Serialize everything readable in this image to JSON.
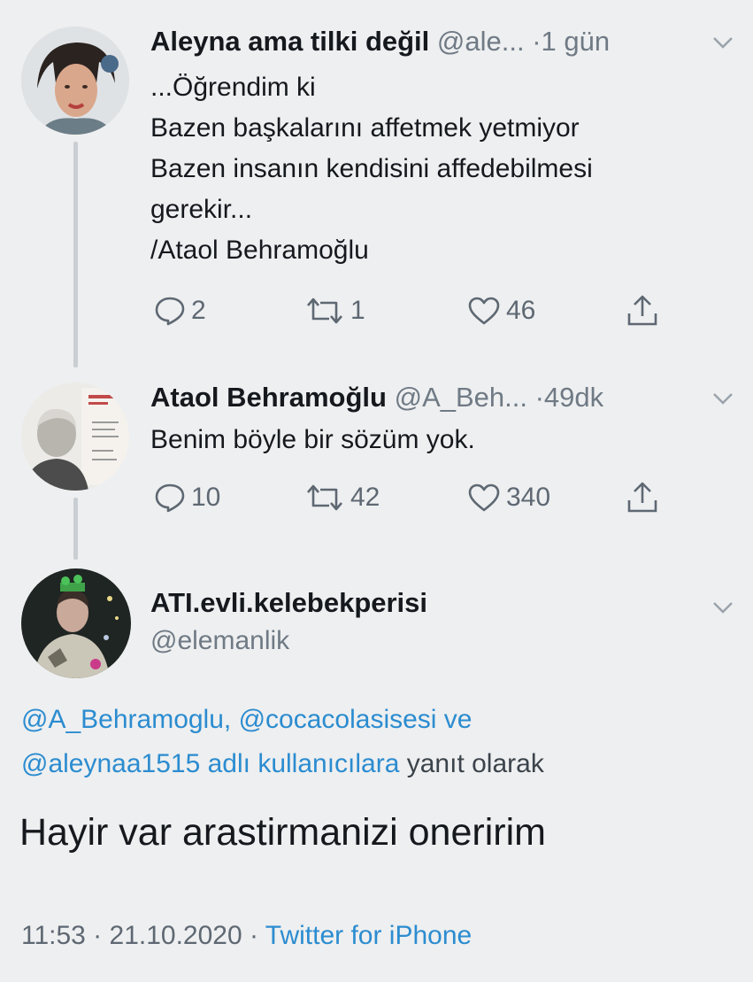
{
  "colors": {
    "background": "#eeeff0",
    "text": "#15191e",
    "muted": "#6f7a85",
    "link": "#2b8cd0"
  },
  "tweet1": {
    "name": "Aleyna ama tilki değil",
    "handle": "@ale...",
    "time": "·1 gün",
    "lines": [
      "...Öğrendim ki",
      "Bazen başkalarını affetmek yetmiyor",
      "Bazen insanın kendisini affedebilmesi",
      "gerekir...",
      " /Ataol Behramoğlu"
    ],
    "replies": "2",
    "retweets": "1",
    "likes": "46",
    "icons": [
      "reply-icon",
      "retweet-icon",
      "like-icon",
      "share-icon",
      "chevron-down-icon"
    ]
  },
  "tweet2": {
    "name": "Ataol Behramoğlu",
    "handle": "@A_Beh...",
    "time": "·49dk",
    "text": "Benim böyle bir sözüm yok.",
    "replies": "10",
    "retweets": "42",
    "likes": "340"
  },
  "tweet3": {
    "name": "ATI.evli.kelebekperisi",
    "handle": "@elemanlik",
    "reply_mentions_line1": "@A_Behramoglu, @cocacolasisesi ve",
    "reply_mentions_line2": "@aleynaa1515 adlı kullanıcılara",
    "reply_suffix": "yanıt olarak",
    "text": "Hayir var arastirmanizi oneririm",
    "timestamp": "11:53 · 21.10.2020 ·",
    "source": "Twitter for iPhone"
  }
}
